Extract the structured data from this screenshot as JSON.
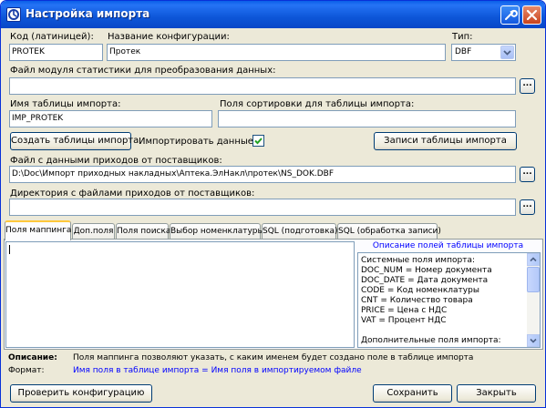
{
  "window": {
    "title": "Настройка импорта"
  },
  "fields": {
    "code_label": "Код (латиницей):",
    "code_value": "PROTEK",
    "config_name_label": "Название конфигурации:",
    "config_name_value": "Протек",
    "type_label": "Тип:",
    "type_value": "DBF",
    "stats_module_label": "Файл модуля статистики для преобразования данных:",
    "stats_module_value": "",
    "import_table_label": "Имя таблицы импорта:",
    "import_table_value": "IMP_PROTEK",
    "sort_fields_label": "Поля сортировки для таблицы импорта:",
    "sort_fields_value": "",
    "supplier_file_label": "Файл с данными приходов от поставщиков:",
    "supplier_file_value": "D:\\Doc\\Импорт приходных накладных\\Аптека.ЭлНакл\\протек\\NS_DOK.DBF",
    "supplier_dir_label": "Директория с файлами приходов от поставщиков:",
    "supplier_dir_value": ""
  },
  "buttons": {
    "browse": "...",
    "create_table": "Создать таблицы импорта",
    "import_data_label": "Импортировать данные",
    "import_data_checked": true,
    "table_records": "Записи таблицы импорта",
    "check_config": "Проверить конфигурацию",
    "save": "Сохранить",
    "close": "Закрыть"
  },
  "tabs": [
    {
      "label": "Поля маппинга",
      "active": true
    },
    {
      "label": "Доп.поля",
      "active": false
    },
    {
      "label": "Поля поиска",
      "active": false
    },
    {
      "label": "Выбор номенклатуры",
      "active": false
    },
    {
      "label": "SQL (подготовка)",
      "active": false
    },
    {
      "label": "SQL (обработка записи)",
      "active": false
    }
  ],
  "description_panel": {
    "title": "Описание полей таблицы импорта",
    "lines": [
      "Системные поля импорта:",
      "DOC_NUM = Номер документа",
      "DOC_DATE = Дата документа",
      "CODE = Код номенклатуры",
      "CNT = Количество товара",
      "PRICE = Цена с НДС",
      "VAT = Процент НДС",
      "",
      "Дополнительные поля импорта:"
    ]
  },
  "footer": {
    "description_label": "Описание:",
    "description_text": "Поля маппинга позволяют указать, с каким именем будет создано поле в таблице импорта",
    "format_label": "Формат:",
    "format_text": "Имя поля в таблице импорта = Имя поля в импортируемом файле"
  },
  "colors": {
    "titlebar": "#0a5fe8",
    "window_bg": "#ece9d8",
    "accent_blue_text": "#0000ff",
    "active_tab_highlight": "#ffc83c"
  }
}
